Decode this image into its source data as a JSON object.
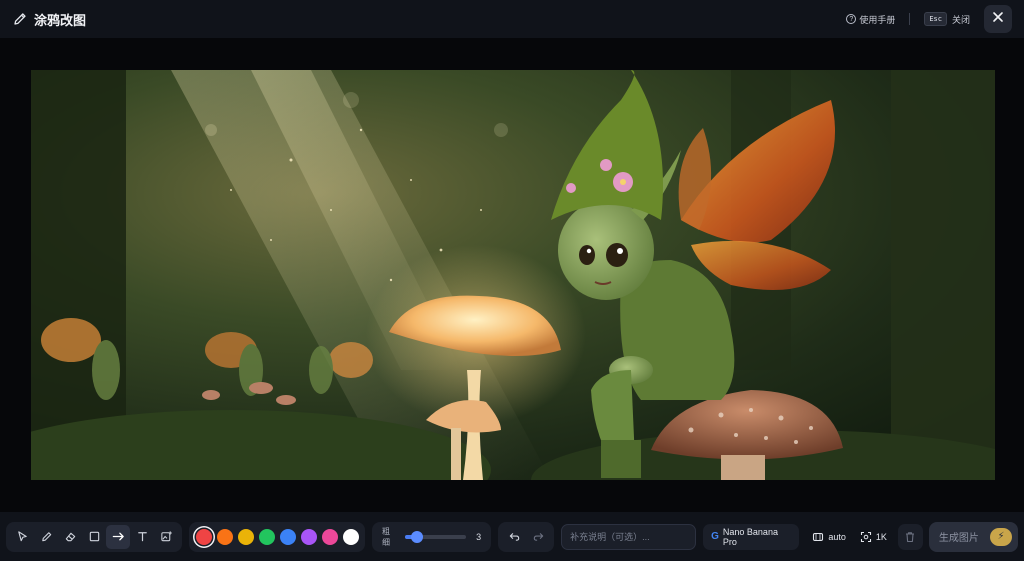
{
  "header": {
    "title": "涂鸦改图",
    "help_label": "使用手册",
    "esc_key": "Esc",
    "close_label": "关闭"
  },
  "icons": {
    "title": "pencil-icon",
    "help": "question-circle-icon",
    "close": "close-icon"
  },
  "toolbar": {
    "tools": [
      {
        "name": "select",
        "icon": "cursor-icon",
        "active": false
      },
      {
        "name": "brush",
        "icon": "pencil-icon",
        "active": false
      },
      {
        "name": "eraser",
        "icon": "eraser-icon",
        "active": false
      },
      {
        "name": "rectangle",
        "icon": "rectangle-icon",
        "active": false
      },
      {
        "name": "arrow",
        "icon": "arrow-right-icon",
        "active": true
      },
      {
        "name": "text",
        "icon": "text-icon",
        "active": false
      },
      {
        "name": "image",
        "icon": "image-add-icon",
        "active": false
      }
    ],
    "colors": [
      "#ef4444",
      "#f97316",
      "#eab308",
      "#22c55e",
      "#3b82f6",
      "#a855f7",
      "#ec4899",
      "#ffffff"
    ],
    "selected_color": "#ef4444",
    "thickness_label": "粗细",
    "thickness_value": "3",
    "thickness_fraction": 0.2,
    "description_placeholder": "补充说明（可选）...",
    "model_label": "Nano Banana Pro",
    "ratio_label": "auto",
    "resolution_label": "1K",
    "generate_label": "生成图片"
  },
  "accent_color": "#4a7cf3"
}
